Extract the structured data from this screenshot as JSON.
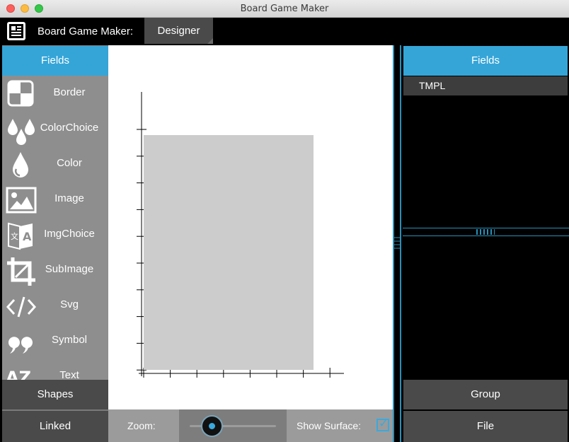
{
  "window": {
    "title": "Board Game Maker"
  },
  "header": {
    "app_label": "Board Game Maker:",
    "active_tab": "Designer"
  },
  "left_panel": {
    "title": "Fields",
    "items": [
      {
        "label": "Border",
        "icon": "border-icon"
      },
      {
        "label": "ColorChoice",
        "icon": "color-choice-icon"
      },
      {
        "label": "Color",
        "icon": "color-drop-icon"
      },
      {
        "label": "Image",
        "icon": "image-icon"
      },
      {
        "label": "ImgChoice",
        "icon": "image-choice-icon"
      },
      {
        "label": "SubImage",
        "icon": "crop-icon"
      },
      {
        "label": "Svg",
        "icon": "code-icon"
      },
      {
        "label": "Symbol",
        "icon": "quote-icon"
      },
      {
        "label": "Text",
        "icon": "text-az-icon"
      }
    ],
    "shapes_button": "Shapes",
    "linked_button": "Linked"
  },
  "bottom_bar": {
    "zoom_label": "Zoom:",
    "zoom_level": 0.25,
    "show_surface_label": "Show Surface:",
    "show_surface_checked": true
  },
  "right_panel": {
    "title": "Fields",
    "items": [
      "TMPL"
    ],
    "group_button": "Group",
    "file_button": "File"
  },
  "colors": {
    "accent": "#35a5d8",
    "panel_dark": "#4a4a4a",
    "panel_gray": "#8e8e8e",
    "canvas_card": "#cccccc"
  }
}
